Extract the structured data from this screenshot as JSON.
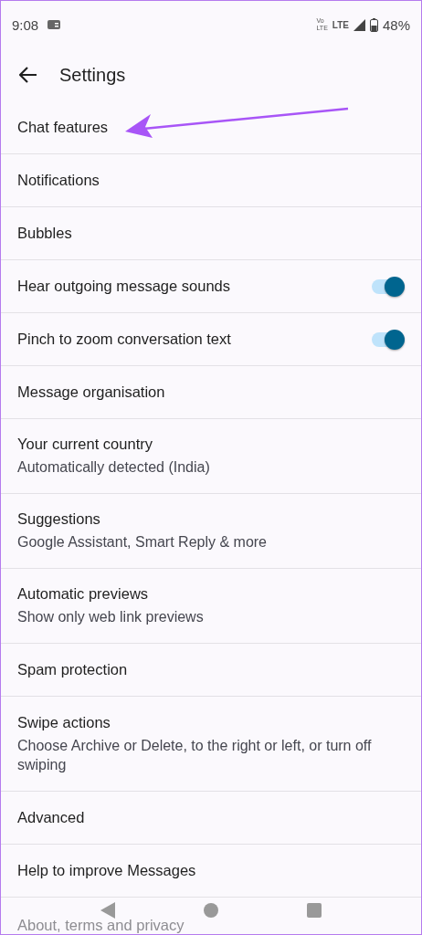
{
  "status_bar": {
    "time": "9:08",
    "volte_top": "Vo",
    "volte_bottom": "LTE",
    "network": "LTE",
    "battery": "48%"
  },
  "header": {
    "title": "Settings"
  },
  "items": [
    {
      "kind": "plain",
      "title": "Chat features",
      "annotated": true
    },
    {
      "kind": "plain",
      "title": "Notifications"
    },
    {
      "kind": "plain",
      "title": "Bubbles"
    },
    {
      "kind": "toggle",
      "title": "Hear outgoing message sounds",
      "on": true
    },
    {
      "kind": "toggle",
      "title": "Pinch to zoom conversation text",
      "on": true
    },
    {
      "kind": "plain",
      "title": "Message organisation"
    },
    {
      "kind": "plain",
      "title": "Your current country",
      "subtitle": "Automatically detected (India)"
    },
    {
      "kind": "plain",
      "title": "Suggestions",
      "subtitle": "Google Assistant, Smart Reply & more"
    },
    {
      "kind": "plain",
      "title": "Automatic previews",
      "subtitle": "Show only web link previews"
    },
    {
      "kind": "plain",
      "title": "Spam protection"
    },
    {
      "kind": "plain",
      "title": "Swipe actions",
      "subtitle": "Choose Archive or Delete, to the right or left, or turn off swiping"
    },
    {
      "kind": "plain",
      "title": "Advanced"
    },
    {
      "kind": "plain",
      "title": "Help to improve Messages"
    },
    {
      "kind": "obscured",
      "title": "About, terms and privacy"
    }
  ]
}
